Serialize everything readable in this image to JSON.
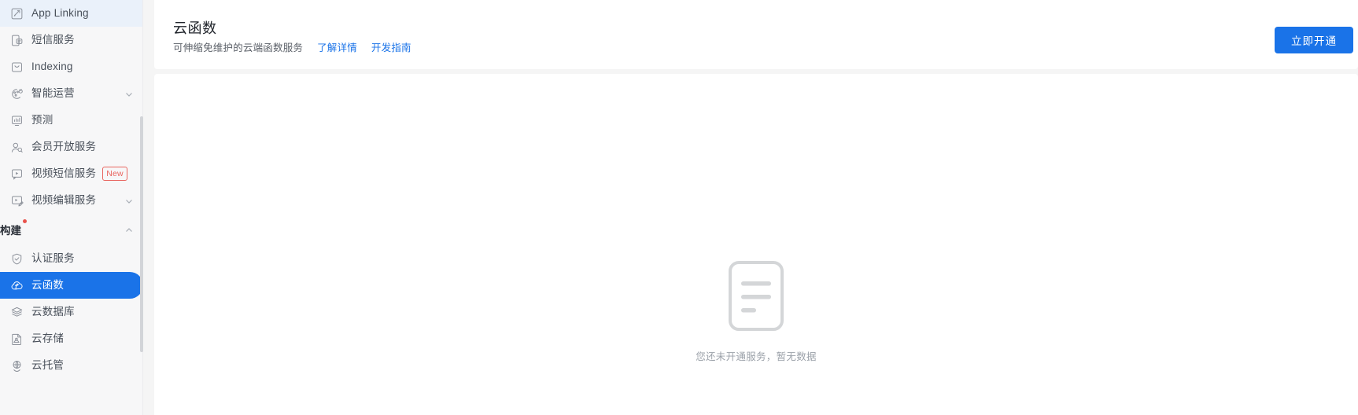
{
  "sidebar": {
    "items": [
      {
        "label": "App Linking",
        "icon": "app-linking-icon",
        "state": "hovered",
        "chevron": false,
        "badge": null
      },
      {
        "label": "短信服务",
        "icon": "sms-icon",
        "state": "normal",
        "chevron": false,
        "badge": null
      },
      {
        "label": "Indexing",
        "icon": "indexing-icon",
        "state": "normal",
        "chevron": false,
        "badge": null
      },
      {
        "label": "智能运营",
        "icon": "smart-ops-icon",
        "state": "normal",
        "chevron": true,
        "badge": null
      },
      {
        "label": "预测",
        "icon": "prediction-icon",
        "state": "normal",
        "chevron": false,
        "badge": null
      },
      {
        "label": "会员开放服务",
        "icon": "member-icon",
        "state": "normal",
        "chevron": false,
        "badge": null
      },
      {
        "label": "视频短信服务",
        "icon": "video-sms-icon",
        "state": "normal",
        "chevron": false,
        "badge": "New"
      },
      {
        "label": "视频编辑服务",
        "icon": "video-edit-icon",
        "state": "normal",
        "chevron": true,
        "badge": null
      }
    ],
    "group": {
      "label": "构建",
      "has_dot": true,
      "expanded": true
    },
    "group_items": [
      {
        "label": "认证服务",
        "icon": "shield-check-icon",
        "state": "normal",
        "chevron": false,
        "badge": null
      },
      {
        "label": "云函数",
        "icon": "cloud-function-icon",
        "state": "selected",
        "chevron": false,
        "badge": null
      },
      {
        "label": "云数据库",
        "icon": "database-layers-icon",
        "state": "normal",
        "chevron": false,
        "badge": null
      },
      {
        "label": "云存储",
        "icon": "cloud-storage-icon",
        "state": "normal",
        "chevron": false,
        "badge": null
      },
      {
        "label": "云托管",
        "icon": "cloud-hosting-icon",
        "state": "normal",
        "chevron": false,
        "badge": null
      }
    ]
  },
  "header": {
    "title": "云函数",
    "subtitle": "可伸缩免维护的云端函数服务",
    "link_details": "了解详情",
    "link_guide": "开发指南",
    "cta_label": "立即开通"
  },
  "empty_state": {
    "icon": "empty-document-icon",
    "message": "您还未开通服务，暂无数据"
  },
  "colors": {
    "accent": "#1a73e8",
    "hover_bg": "#eaf1fa",
    "badge_red": "#e8655f",
    "dot_red": "#e8514b",
    "sidebar_bg": "#f7f7f8",
    "page_bg": "#f5f5f5",
    "empty_gray": "#d2d4d6"
  }
}
